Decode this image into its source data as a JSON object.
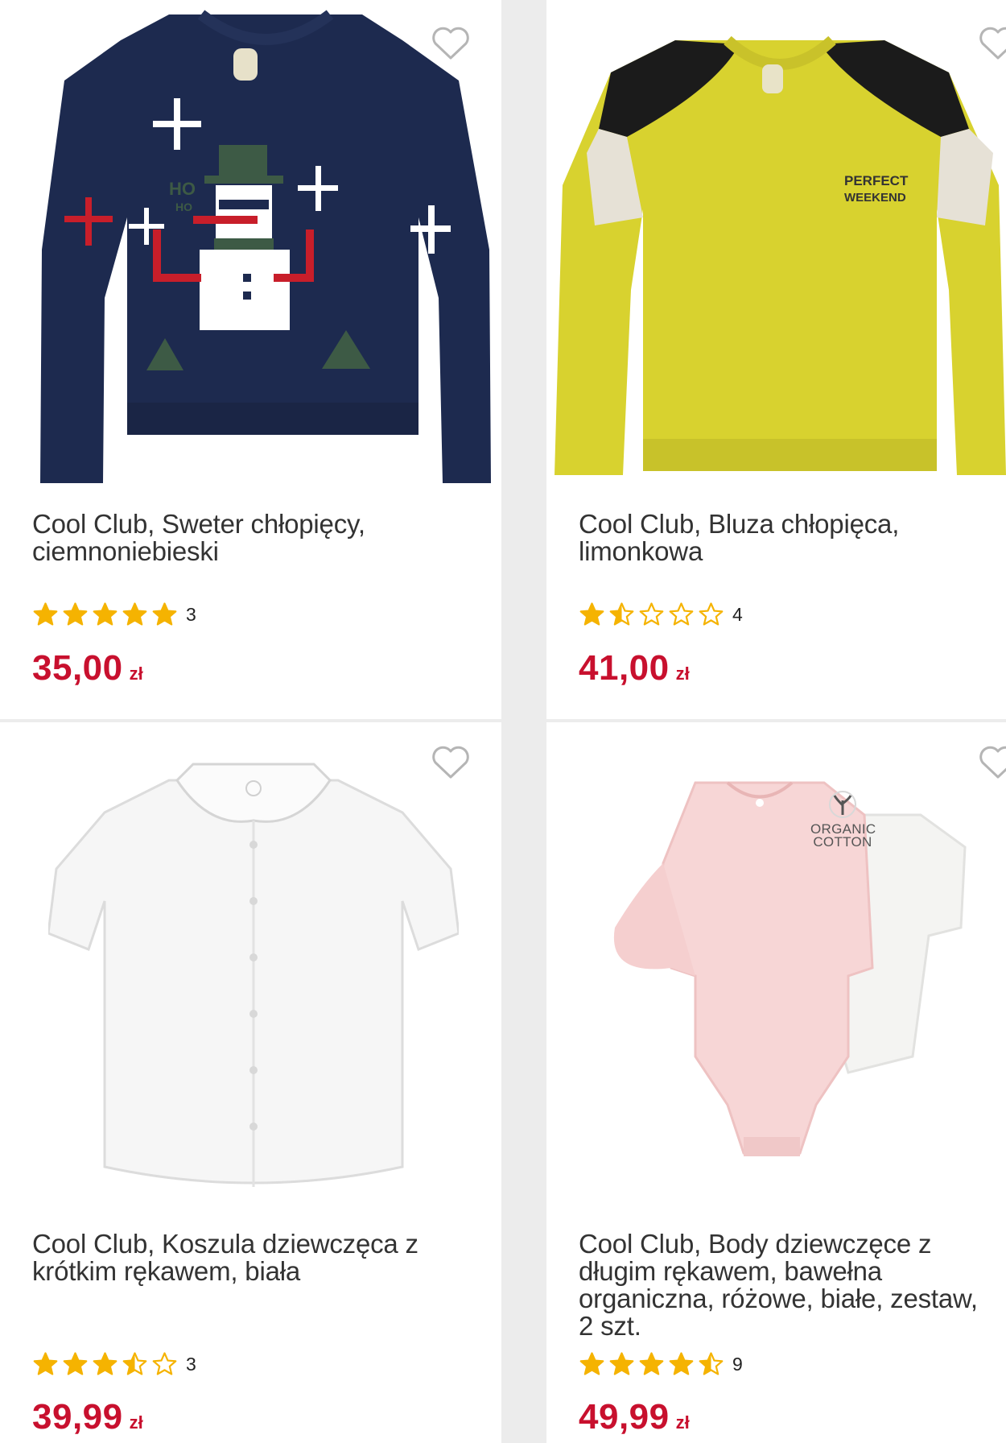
{
  "products": [
    {
      "title": "Cool Club, Sweter chłopięcy, ciemnoniebieski",
      "rating": 5,
      "reviews": "3",
      "price": "35,00",
      "currency": "zł"
    },
    {
      "title": "Cool Club, Bluza chłopięca, limonkowa",
      "rating": 1.5,
      "reviews": "4",
      "price": "41,00",
      "currency": "zł"
    },
    {
      "title": "Cool Club, Koszula dziewczęca z krótkim rękawem, biała",
      "rating": 3.5,
      "reviews": "3",
      "price": "39,99",
      "currency": "zł"
    },
    {
      "title": "Cool Club, Body dziewczęce z długim rękawem, bawełna organiczna, różowe, białe, zestaw, 2 szt.",
      "rating": 4.5,
      "reviews": "9",
      "price": "49,99",
      "currency": "zł",
      "badge_line1": "ORGANIC",
      "badge_line2": "COTTON"
    }
  ],
  "sweater_print": {
    "line1": "HO",
    "line2": "HO"
  },
  "sweatshirt_print": {
    "line1": "PERFECT",
    "line2": "WEEKEND"
  },
  "colors": {
    "price": "#c8102e",
    "star": "#f5b301",
    "star_empty": "#f5b301"
  }
}
